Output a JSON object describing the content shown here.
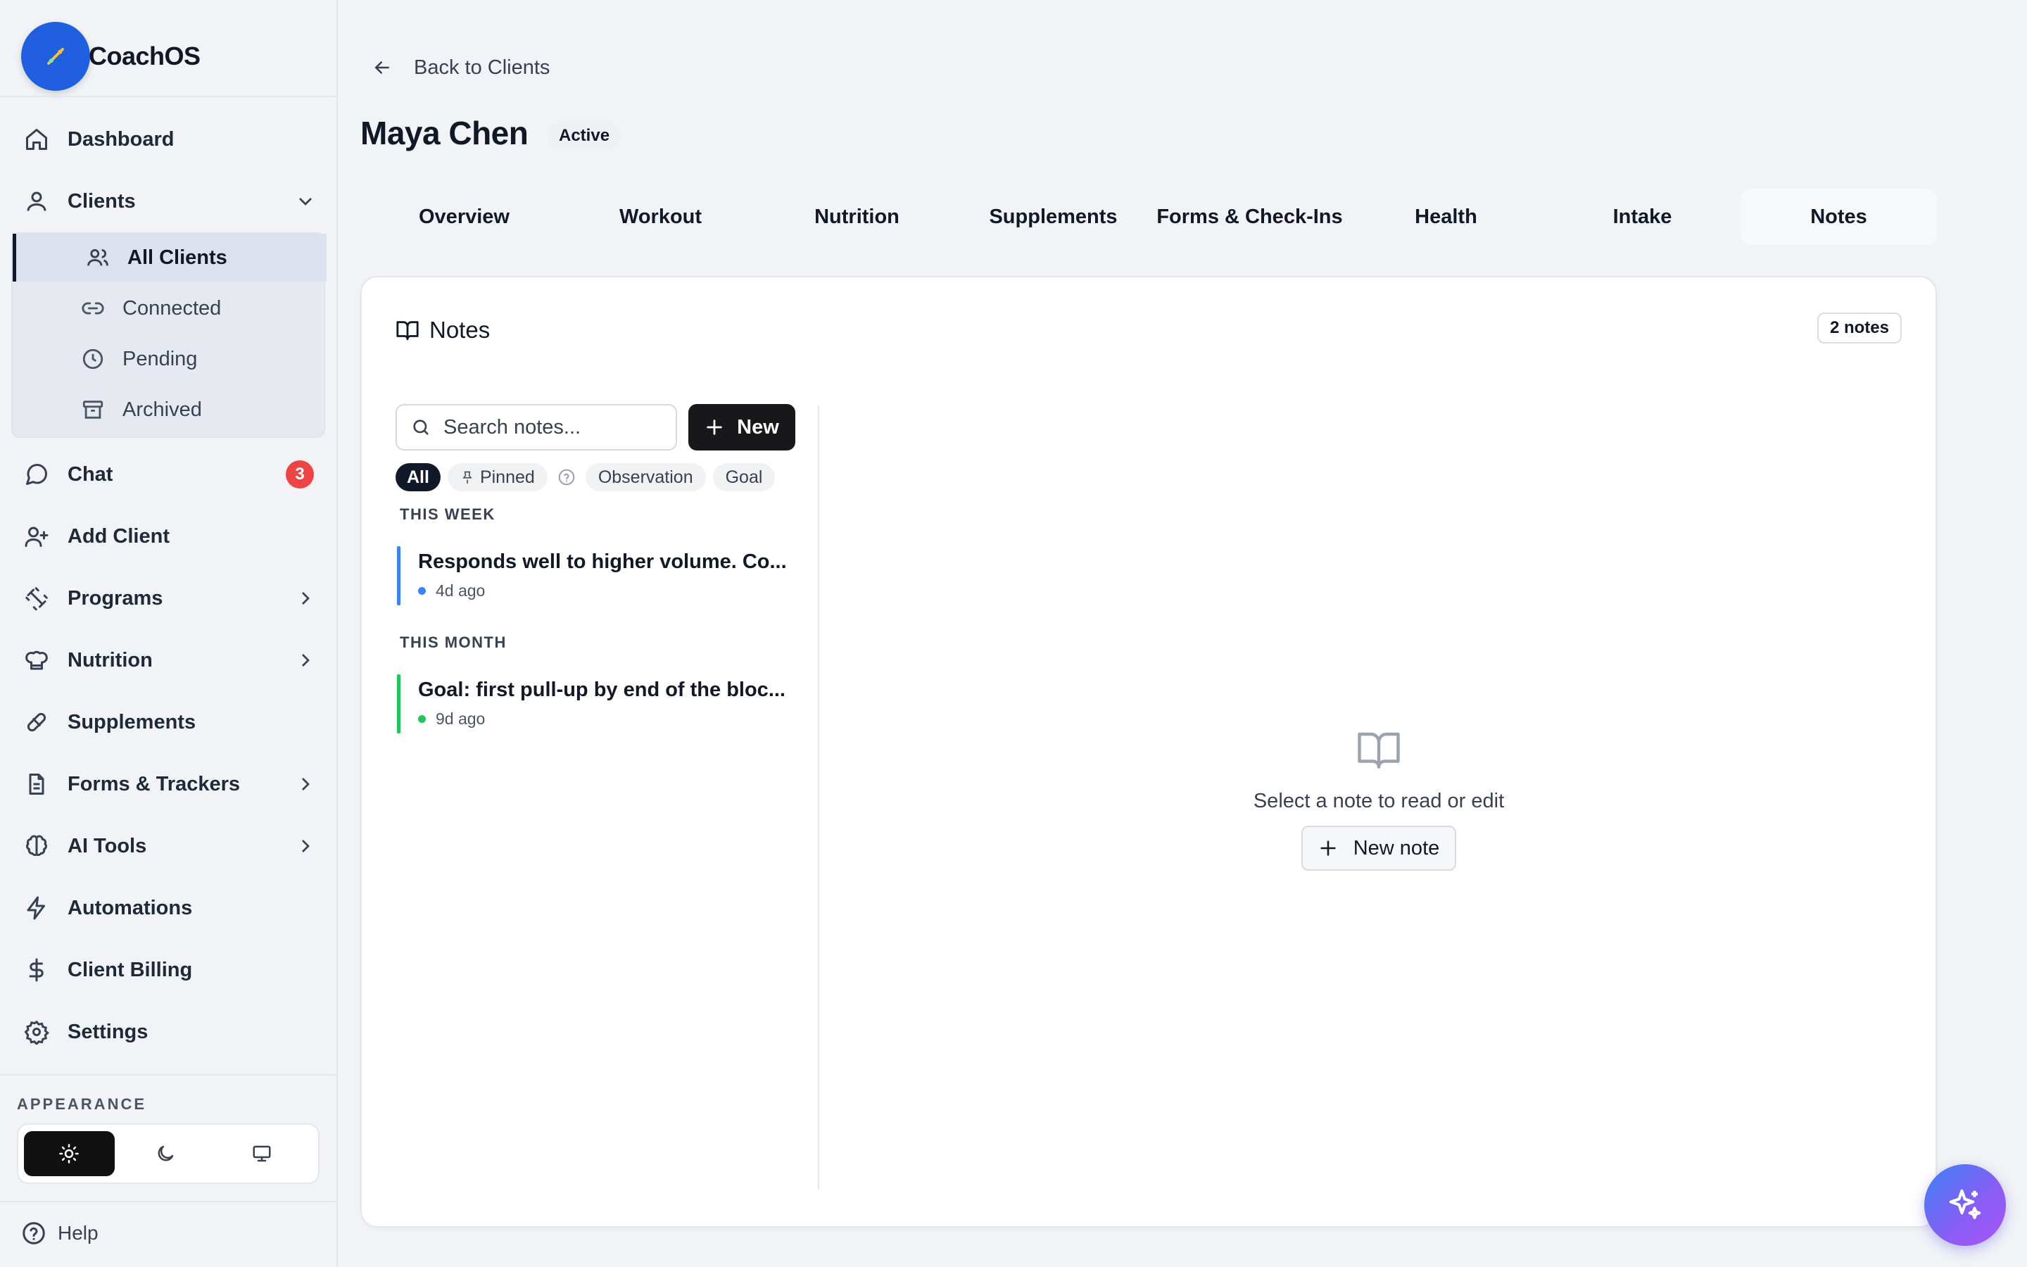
{
  "app": {
    "name": "CoachOS"
  },
  "sidebar": {
    "nav": [
      {
        "label": "Dashboard",
        "icon": "home-icon"
      },
      {
        "label": "Clients",
        "icon": "user-icon",
        "expanded": true
      },
      {
        "label": "Chat",
        "icon": "message-circle-icon",
        "badge": "3"
      },
      {
        "label": "Add Client",
        "icon": "user-plus-icon"
      },
      {
        "label": "Programs",
        "icon": "dumbbell-icon"
      },
      {
        "label": "Nutrition",
        "icon": "chef-hat-icon"
      },
      {
        "label": "Supplements",
        "icon": "pill-icon"
      },
      {
        "label": "Forms & Trackers",
        "icon": "file-text-icon"
      },
      {
        "label": "AI Tools",
        "icon": "brain-icon"
      },
      {
        "label": "Automations",
        "icon": "zap-icon"
      },
      {
        "label": "Client Billing",
        "icon": "dollar-sign-icon"
      },
      {
        "label": "Settings",
        "icon": "gear-icon"
      }
    ],
    "clients_sub": [
      {
        "label": "All Clients",
        "icon": "users-icon",
        "active": true
      },
      {
        "label": "Connected",
        "icon": "link-icon"
      },
      {
        "label": "Pending",
        "icon": "clock-icon"
      },
      {
        "label": "Archived",
        "icon": "archive-icon"
      }
    ],
    "appearance_label": "APPEARANCE",
    "theme_options": [
      "light",
      "dark",
      "system"
    ],
    "theme_selected": "light",
    "help_label": "Help"
  },
  "header": {
    "back_label": "Back to Clients",
    "client_name": "Maya Chen",
    "status": "Active"
  },
  "tabs": [
    {
      "label": "Overview"
    },
    {
      "label": "Workout"
    },
    {
      "label": "Nutrition"
    },
    {
      "label": "Supplements"
    },
    {
      "label": "Forms & Check-Ins"
    },
    {
      "label": "Health"
    },
    {
      "label": "Intake"
    },
    {
      "label": "Notes",
      "active": true
    }
  ],
  "notes": {
    "title": "Notes",
    "count_label": "2 notes",
    "search_placeholder": "Search notes...",
    "new_label": "New",
    "filters": [
      {
        "label": "All",
        "active": true
      },
      {
        "label": "Pinned"
      },
      {
        "label": "Observation"
      },
      {
        "label": "Goal"
      }
    ],
    "groups": [
      {
        "label": "THIS WEEK",
        "items": [
          {
            "title": "Responds well to higher volume. Co...",
            "time": "4d ago",
            "color": "#3b82f6"
          }
        ]
      },
      {
        "label": "THIS MONTH",
        "items": [
          {
            "title": "Goal: first pull-up by end of the bloc...",
            "time": "9d ago",
            "color": "#22c55e"
          }
        ]
      }
    ],
    "empty_text": "Select a note to read or edit",
    "new_note_label": "New note"
  },
  "colors": {
    "accent": "#1f5fe0",
    "badge": "#ef4444",
    "observation": "#3b82f6",
    "goal": "#22c55e"
  }
}
